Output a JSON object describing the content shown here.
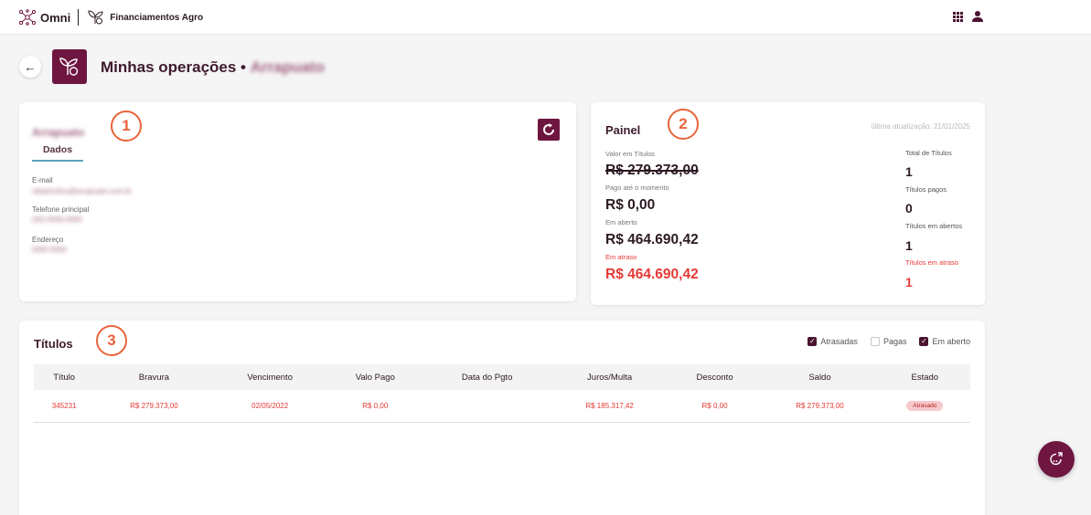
{
  "header": {
    "brand": "Omni",
    "product": "Financiamentos Agro"
  },
  "page": {
    "title": "Minhas operações •",
    "title_suffix": "Arrapuato"
  },
  "annotations": [
    "1",
    "2",
    "3"
  ],
  "contact": {
    "name": "Arrapuato",
    "tab": "Dados",
    "email_label": "E-mail",
    "email_value": "rafaelrufino@arrapuato.com.br",
    "phone_label": "Telefone principal",
    "phone_value": "(00) 0000-0000",
    "address_label": "Endereço",
    "address_value": "0000 0000"
  },
  "panel": {
    "title": "Painel",
    "last_update": "última atualização: 21/01/2025",
    "valor_label": "Valor em Títulos",
    "valor_value": "R$ 279.373,00",
    "pago_label": "Pago até o momento",
    "pago_value": "R$ 0,00",
    "aberto_label": "Em aberto",
    "aberto_value": "R$ 464.690,42",
    "atraso_label": "Em atraso",
    "atraso_value": "R$ 464.690,42",
    "total_label": "Total de Títulos",
    "total_value": "1",
    "pagos_label": "Títulos pagos",
    "pagos_value": "0",
    "abertos_label": "Títulos em abertos",
    "abertos_value": "1",
    "em_atraso_label": "Títulos em atraso",
    "em_atraso_value": "1"
  },
  "titles": {
    "heading": "Títulos",
    "filters": [
      {
        "label": "Atrasadas",
        "checked": true
      },
      {
        "label": "Pagas",
        "checked": false
      },
      {
        "label": "Em aberto",
        "checked": true
      }
    ],
    "columns": [
      "Título",
      "Bravura",
      "Vencimento",
      "Valo Pago",
      "Data do Pgto",
      "Juros/Multa",
      "Desconto",
      "Saldo",
      "Estado"
    ],
    "rows": [
      {
        "titulo": "345231",
        "bravura": "R$ 279.373,00",
        "vencimento": "02/05/2022",
        "valor_pago": "R$ 0,00",
        "data_pgto": "",
        "juros_multa": "R$ 185.317,42",
        "desconto": "R$ 0,00",
        "saldo": "R$ 279.373,00",
        "estado": "Atrasado"
      }
    ]
  },
  "colors": {
    "brand": "#6e1540",
    "accent": "#e9643a",
    "danger": "#e53935"
  },
  "icons": {
    "logo": "omni-network-icon",
    "product": "plant-coin-icon",
    "apps": "apps-grid-icon",
    "user": "user-icon",
    "back": "arrow-left-icon",
    "refresh": "refresh-icon",
    "chat": "chat-support-icon"
  }
}
